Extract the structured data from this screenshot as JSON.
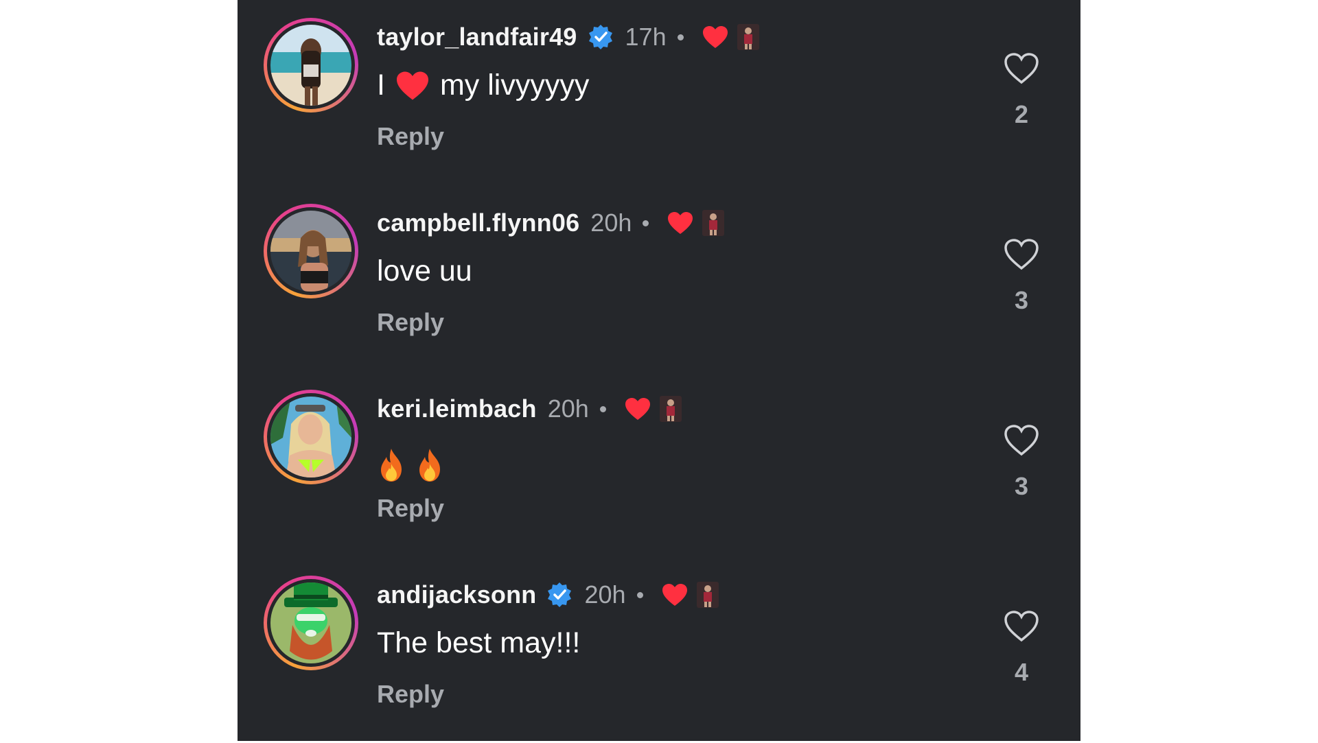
{
  "comments": [
    {
      "username": "taylor_landfair49",
      "verified": true,
      "time": "17h",
      "text_before": "I",
      "text_emoji": "red-heart",
      "text_after": "my livyyyyy",
      "reply_label": "Reply",
      "likes": "2",
      "avatar_icon": "beach-portrait"
    },
    {
      "username": "campbell.flynn06",
      "verified": false,
      "time": "20h",
      "text": "love uu",
      "reply_label": "Reply",
      "likes": "3",
      "avatar_icon": "sunset-portrait"
    },
    {
      "username": "keri.leimbach",
      "verified": false,
      "time": "20h",
      "text_emoji": "fire fire",
      "reply_label": "Reply",
      "likes": "3",
      "avatar_icon": "poolside-portrait"
    },
    {
      "username": "andijacksonn",
      "verified": true,
      "time": "20h",
      "text": "The best may!!!",
      "reply_label": "Reply",
      "likes": "4",
      "avatar_icon": "leprechaun-portrait"
    }
  ],
  "colors": {
    "background": "#25272b",
    "username": "#f5f5f5",
    "muted": "#a8abb0",
    "heart": "#ff3040",
    "verified": "#3897f0"
  }
}
